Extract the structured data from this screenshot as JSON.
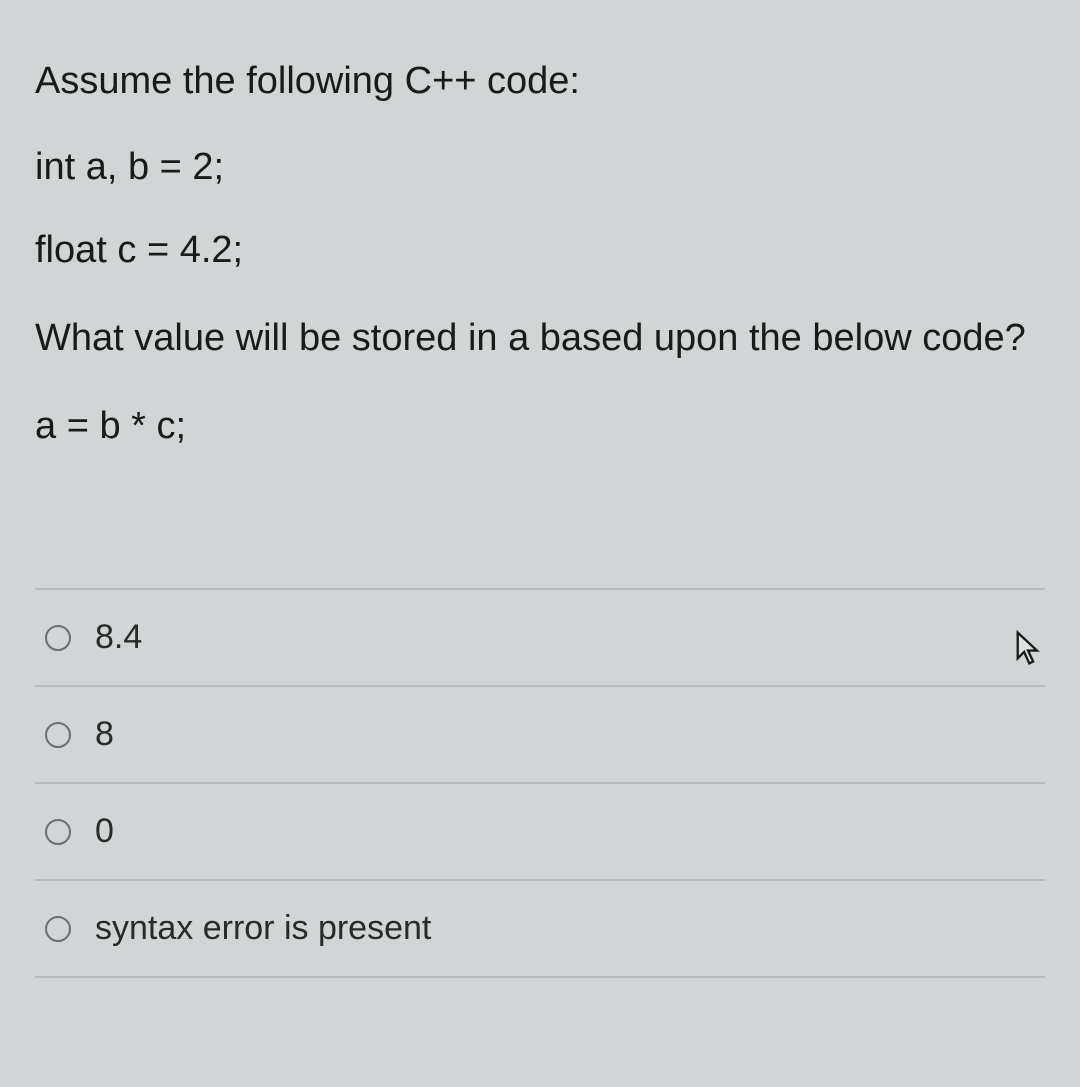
{
  "question": {
    "intro": "Assume the following C++ code:",
    "code_line_1": "int a, b = 2;",
    "code_line_2": "float c = 4.2;",
    "prompt": "What value will be stored in a based upon the below code?",
    "expression": "a = b * c;"
  },
  "options": [
    {
      "label": "8.4"
    },
    {
      "label": "8"
    },
    {
      "label": "0"
    },
    {
      "label": "syntax error is present"
    }
  ]
}
